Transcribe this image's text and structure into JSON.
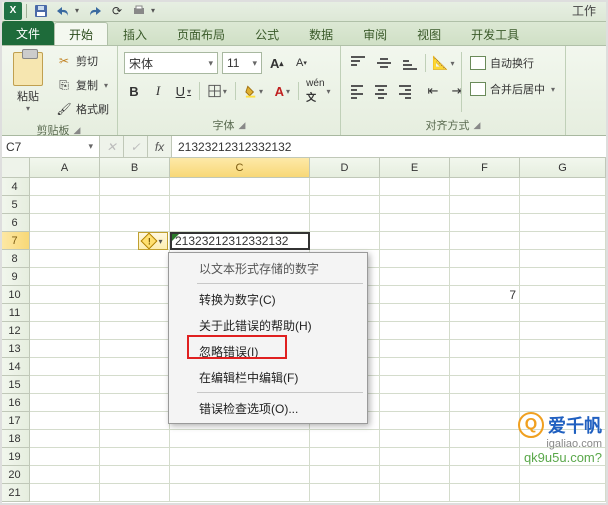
{
  "qat": {
    "app_right": "工作"
  },
  "ribbon": {
    "file": "文件",
    "tabs": [
      "开始",
      "插入",
      "页面布局",
      "公式",
      "数据",
      "审阅",
      "视图",
      "开发工具"
    ],
    "active_tab_index": 0,
    "clipboard": {
      "paste": "粘贴",
      "cut": "剪切",
      "copy": "复制",
      "format_painter": "格式刷",
      "group": "剪贴板"
    },
    "font": {
      "name": "宋体",
      "size": "11",
      "group": "字体"
    },
    "align": {
      "wrap": "自动换行",
      "merge": "合并后居中",
      "group": "对齐方式"
    }
  },
  "namebox": "C7",
  "fx_label": "fx",
  "formula": "21323212312332132",
  "columns": [
    "A",
    "B",
    "C",
    "D",
    "E",
    "F",
    "G"
  ],
  "active_col": "C",
  "rows": [
    4,
    5,
    6,
    7,
    8,
    9,
    10,
    11,
    12,
    13,
    14,
    15,
    16,
    17,
    18,
    19,
    20,
    21
  ],
  "active_row": 7,
  "cell_c7": "21323212312332132",
  "cell_f10": "7",
  "smart_tag": {
    "icon": "!"
  },
  "ctx": {
    "title": "以文本形式存储的数字",
    "items": [
      "转换为数字(C)",
      "关于此错误的帮助(H)",
      "忽略错误(I)",
      "在编辑栏中编辑(F)",
      "错误检查选项(O)..."
    ],
    "highlight_index": 2
  },
  "watermark": {
    "brand": "爱千帆",
    "url1": "igaliao.com",
    "url2": "qk9u5u.com?"
  }
}
